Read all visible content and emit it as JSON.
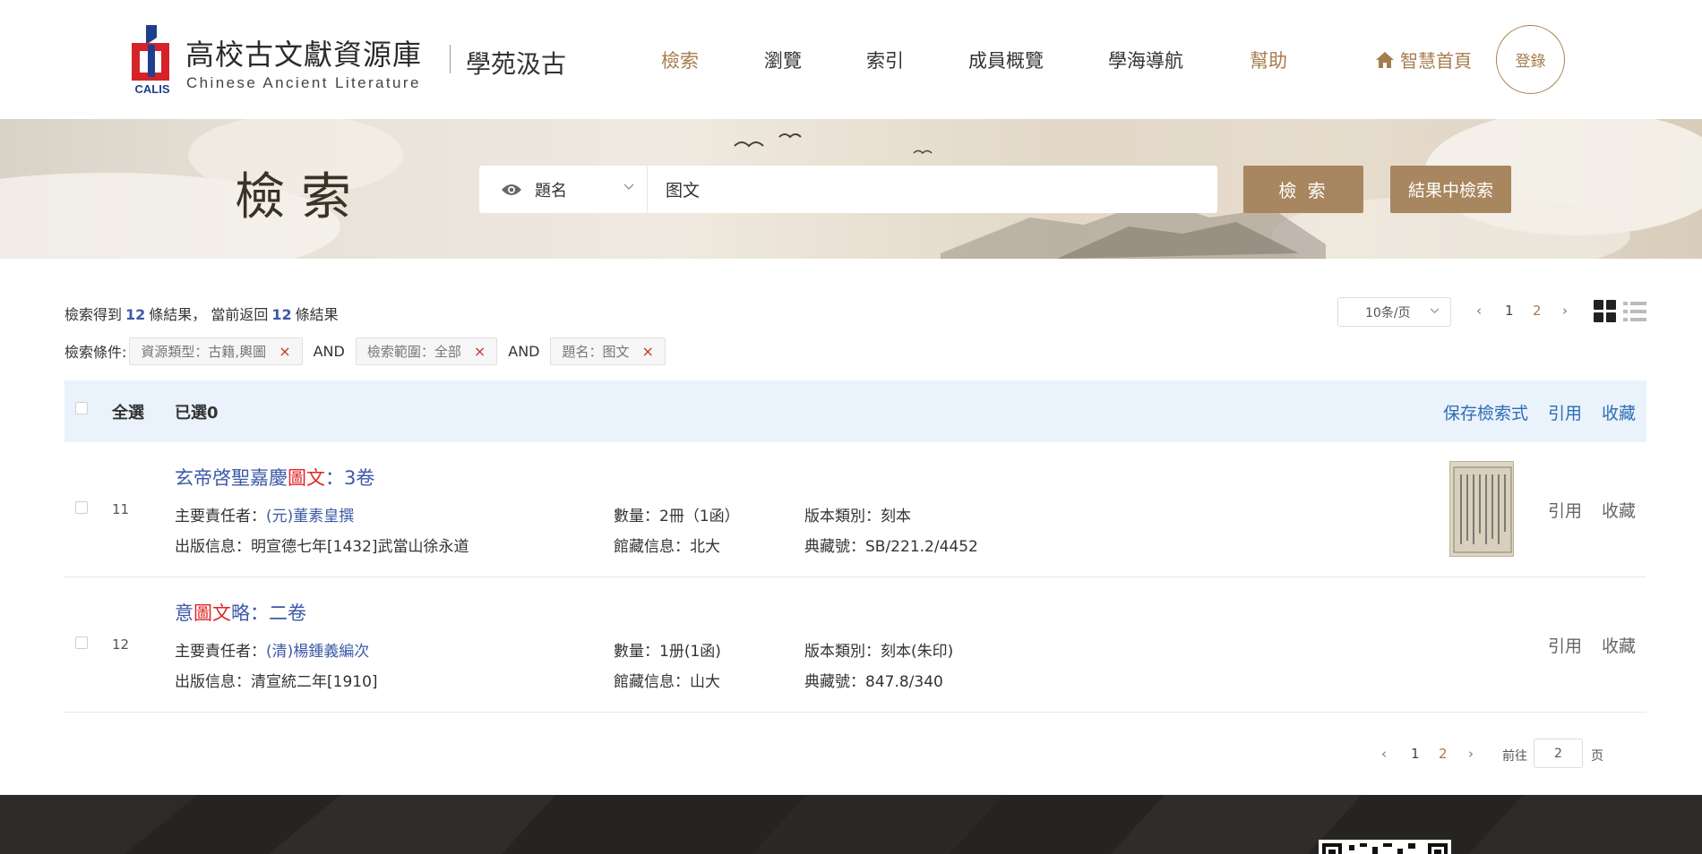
{
  "header": {
    "logo_text": "CALIS",
    "title": "高校古文獻資源庫",
    "subtitle": "Chinese Ancient Literature",
    "side_title": "學苑汲古",
    "nav": [
      {
        "label": "檢索"
      },
      {
        "label": "瀏覽"
      },
      {
        "label": "索引"
      },
      {
        "label": "成員概覽"
      },
      {
        "label": "學海導航"
      },
      {
        "label": "幫助"
      }
    ],
    "home_label": "智慧首頁",
    "login_label": "登錄"
  },
  "banner": {
    "title": "檢索"
  },
  "search": {
    "field_type": "題名",
    "query": "图文",
    "search_button": "檢 索",
    "search_within_button": "結果中檢索"
  },
  "results": {
    "summary_prefix": "檢索得到",
    "total": "12",
    "summary_mid": "條結果，  當前返回",
    "returned": "12",
    "summary_suffix": "條結果",
    "per_page": "10条/页",
    "pages": [
      "1",
      "2"
    ],
    "current_page": "2"
  },
  "conditions": {
    "label": "檢索條件:",
    "connector": "AND",
    "tags": [
      {
        "text": "資源類型：古籍,輿圖"
      },
      {
        "text": "檢索範圍：全部"
      },
      {
        "text": "題名：图文"
      }
    ]
  },
  "list_header": {
    "select_all": "全選",
    "selected": "已選0",
    "actions": [
      "保存檢索式",
      "引用",
      "收藏"
    ]
  },
  "records": [
    {
      "num": "11",
      "title_pre": "玄帝啓聖嘉慶",
      "title_hl": "圖文",
      "title_post": "：3卷",
      "author_label": "主要責任者：",
      "author": "(元)董素皇撰",
      "quantity": "數量：2冊（1函）",
      "edition": "版本類別：刻本",
      "publish": "出版信息：明宣德七年[1432]武當山徐永道",
      "library": "館藏信息：北大",
      "callno": "典藏號：SB/221.2/4452",
      "actions": [
        "引用",
        "收藏"
      ]
    },
    {
      "num": "12",
      "title_pre": "意",
      "title_hl": "圖文",
      "title_post": "略：二卷",
      "author_label": "主要責任者：",
      "author": "(清)楊鍾義編次",
      "quantity": "數量：1册(1函)",
      "edition": "版本類別：刻本(朱印)",
      "publish": "出版信息：清宣統二年[1910]",
      "library": "館藏信息：山大",
      "callno": "典藏號：847.8/340",
      "actions": [
        "引用",
        "收藏"
      ]
    }
  ],
  "pager_bottom": {
    "goto_label": "前往",
    "goto_value": "2",
    "goto_unit": "页"
  },
  "colors": {
    "accent": "#a57c4e",
    "link": "#3c5aa6",
    "highlight": "#e02424",
    "header_bar": "#eaf2fb"
  }
}
